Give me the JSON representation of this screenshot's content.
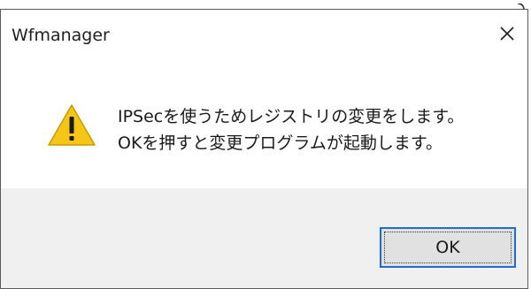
{
  "dialog": {
    "title": "Wfmanager",
    "message_line1": "IPSecを使うためレジストリの変更をします。",
    "message_line2": "OKを押すと変更プログラムが起動します。",
    "icon": "warning-icon",
    "close_icon": "close-icon"
  },
  "buttons": {
    "ok_label": "OK"
  },
  "colors": {
    "warning_fill": "#f5c518",
    "footer_bg": "#f0f0f0",
    "button_focus_border": "#1a6fd1"
  }
}
